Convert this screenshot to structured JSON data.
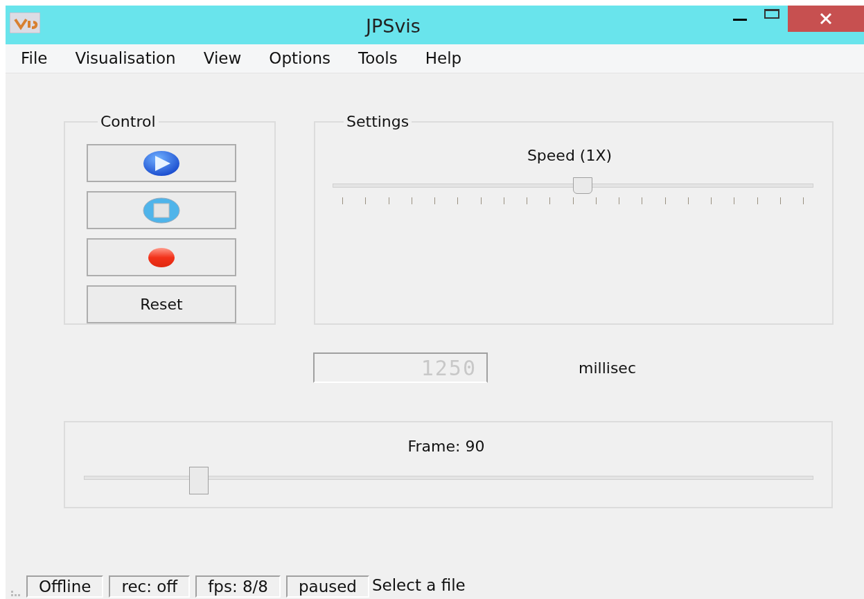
{
  "window": {
    "title": "JPSvis"
  },
  "menu": [
    {
      "label": "File"
    },
    {
      "label": "Visualisation"
    },
    {
      "label": "View"
    },
    {
      "label": "Options"
    },
    {
      "label": "Tools"
    },
    {
      "label": "Help"
    }
  ],
  "control": {
    "title": "Control",
    "buttons": [
      {
        "kind": "play"
      },
      {
        "kind": "stop"
      },
      {
        "kind": "record"
      },
      {
        "kind": "text",
        "label": "Reset"
      }
    ]
  },
  "settings": {
    "title": "Settings",
    "speed": {
      "label": "Speed (1X)",
      "level": 0.52
    }
  },
  "delay": {
    "value": "1250",
    "unit": "millisec"
  },
  "frame": {
    "label": "Frame: 90",
    "level": 0.157
  },
  "status_bar": {
    "fields": [
      "Offline",
      "rec: off",
      "fps: 8/8",
      "paused"
    ],
    "message": "Select a file"
  }
}
